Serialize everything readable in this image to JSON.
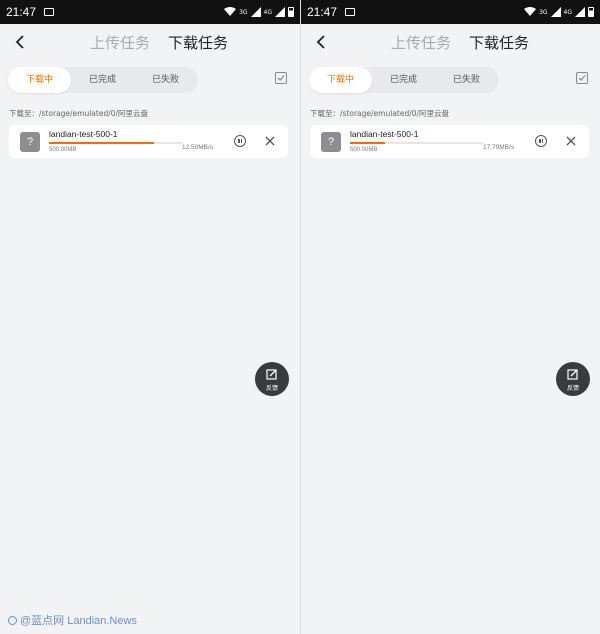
{
  "panels": [
    {
      "status": {
        "time": "21:47",
        "net3g": "3G",
        "net4g": "4G"
      },
      "header": {
        "upload_tab": "上传任务",
        "download_tab": "下载任务"
      },
      "segments": [
        "下载中",
        "已完成",
        "已失败"
      ],
      "path_label": "下载至：/storage/emulated/0/阿里云盘",
      "task": {
        "file_icon": "?",
        "name": "landian-test-500-1",
        "size": "500.00MB",
        "speed": "12.50MB/s",
        "progress_fraction": 0.78
      },
      "feedback_label": "反馈"
    },
    {
      "status": {
        "time": "21:47",
        "net3g": "3G",
        "net4g": "4G"
      },
      "header": {
        "upload_tab": "上传任务",
        "download_tab": "下载任务"
      },
      "segments": [
        "下载中",
        "已完成",
        "已失败"
      ],
      "path_label": "下载至：/storage/emulated/0/阿里云盘",
      "task": {
        "file_icon": "?",
        "name": "landian-test-500-1",
        "size": "500.00MB",
        "speed": "17.79MB/s",
        "progress_fraction": 0.26
      },
      "feedback_label": "反馈"
    }
  ],
  "watermark": "@蓝点网 Landian.News",
  "colors": {
    "accent": "#ff6a00",
    "statusbar": "#111111",
    "background": "#f2f3f5"
  },
  "icons": [
    "back-arrow-icon",
    "select-all-checkbox-icon",
    "pause-icon",
    "close-icon",
    "feedback-edit-icon",
    "wifi-icon",
    "signal-icon",
    "battery-icon",
    "image-notification-icon"
  ]
}
